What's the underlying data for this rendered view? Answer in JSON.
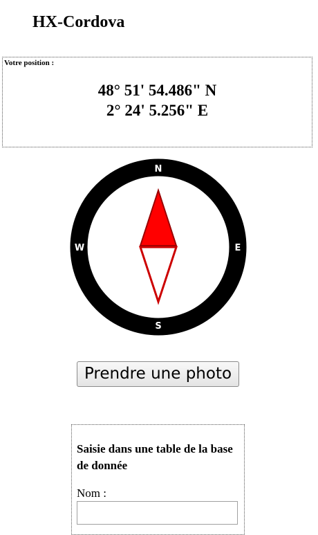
{
  "header": {
    "title": "HX-Cordova"
  },
  "position": {
    "label": "Votre position :",
    "latitude": "48° 51' 54.486\" N",
    "longitude": "2° 24' 5.256\" E"
  },
  "compass": {
    "north": "N",
    "east": "E",
    "south": "S",
    "west": "W",
    "heading_degrees": 0,
    "colors": {
      "ring": "#000000",
      "needle_north": "#ff0000",
      "needle_outline": "#990000",
      "needle_south": "#ffffff"
    }
  },
  "actions": {
    "photo_button_label": "Prendre une photo"
  },
  "form": {
    "heading": "Saisie dans une table de la base de donnée",
    "name_label": "Nom :",
    "name_value": ""
  }
}
